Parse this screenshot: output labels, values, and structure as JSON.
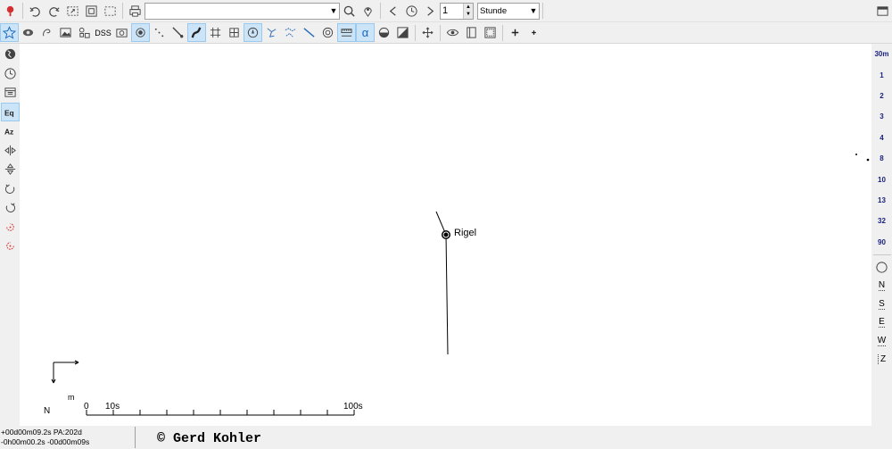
{
  "toolbar": {
    "search_value": "",
    "step_value": "1",
    "time_unit": "Stunde",
    "icons": [
      "star-alert-icon",
      "undo-icon",
      "redo-icon",
      "zoom-rect-icon",
      "zoom-full-icon",
      "select-icon",
      "print-icon",
      "search-icon",
      "location-pin-icon",
      "prev-icon",
      "clock-icon",
      "next-icon"
    ]
  },
  "toolbar2": {
    "dss_label": "DSS",
    "alpha_label": "α"
  },
  "fov_buttons": [
    "30m",
    "1",
    "2",
    "3",
    "4",
    "8",
    "10",
    "13",
    "32",
    "90"
  ],
  "direction_buttons": [
    "N",
    "S",
    "E",
    "W",
    "Z"
  ],
  "map": {
    "star_name": "Rigel",
    "scale_start": "0",
    "scale_mid": "10s",
    "scale_end": "100s",
    "compass_north": "N",
    "compass_east": "m"
  },
  "status": {
    "line1": "+00d00m09.2s PA:202d",
    "line2": "-0h00m00.2s -00d00m09s",
    "copyright": "© Gerd Kohler"
  }
}
